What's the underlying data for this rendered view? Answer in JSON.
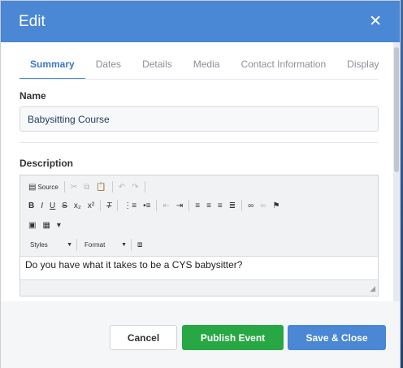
{
  "dialog": {
    "title": "Edit"
  },
  "tabs": [
    "Summary",
    "Dates",
    "Details",
    "Media",
    "Contact Information",
    "Display"
  ],
  "name": {
    "label": "Name",
    "value": "Babysitting Course"
  },
  "description": {
    "label": "Description",
    "source_label": "Source",
    "styles_label": "Styles",
    "format_label": "Format",
    "bold": "B",
    "italic": "I",
    "underline": "U",
    "strike": "S",
    "subscript": "x₂",
    "superscript": "x²",
    "remove_format": "T",
    "content": "Do you have what it takes to be a CYS babysitter?"
  },
  "footer": {
    "cancel": "Cancel",
    "publish": "Publish Event",
    "save_close": "Save & Close"
  },
  "colors": {
    "header": "#4a87d4",
    "publish": "#27a844",
    "save": "#4a87d4",
    "active_tab": "#3a79c6"
  }
}
